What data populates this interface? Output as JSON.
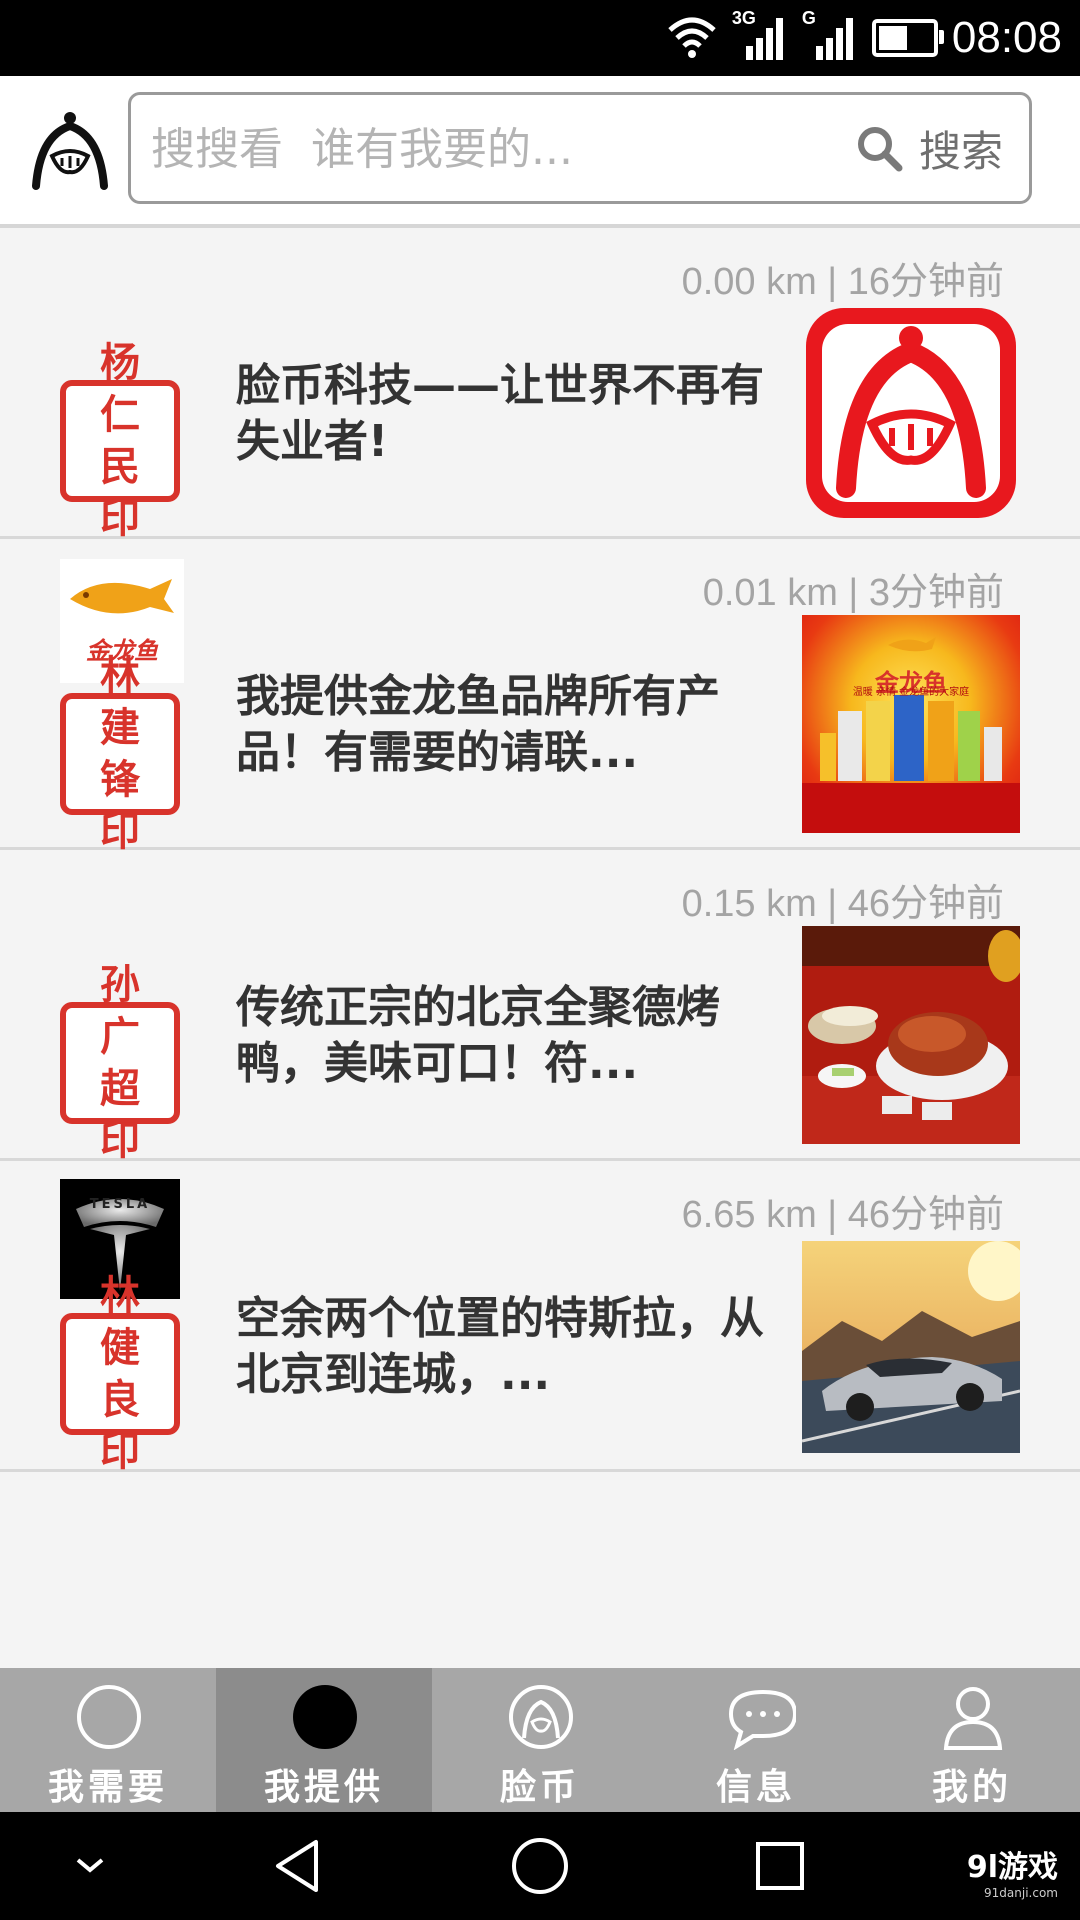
{
  "status_bar": {
    "time": "08:08",
    "net_3g": "3G",
    "net_g": "G",
    "battery_level": 0.55
  },
  "search": {
    "placeholder": "搜搜看  谁有我要的...",
    "button_label": "搜索"
  },
  "posts": [
    {
      "meta": "0.00 km | 16分钟前",
      "seal": [
        "杨",
        "仁",
        "民",
        "印"
      ],
      "title": "脸币科技——让世界不再有失业者!",
      "brand": "none",
      "thumb": "app-logo"
    },
    {
      "meta": "0.01 km | 3分钟前",
      "seal": [
        "林",
        "建",
        "锋",
        "印"
      ],
      "title": "我提供金龙鱼品牌所有产品！有需要的请联...",
      "brand": "金龙鱼",
      "thumb_title": "金龙鱼",
      "thumb_slogan": "温暖 亲情 金龙鱼的大家庭",
      "thumb": "jinlongyu-products"
    },
    {
      "meta": "0.15 km | 46分钟前",
      "seal": [
        "孙",
        "广",
        "超",
        "印"
      ],
      "title": "传统正宗的北京全聚德烤鸭，美味可口！符...",
      "brand": "none",
      "thumb": "roast-duck"
    },
    {
      "meta": "6.65 km | 46分钟前",
      "seal": [
        "林",
        "健",
        "良",
        "印"
      ],
      "title": "空余两个位置的特斯拉，从北京到连城，...",
      "brand": "TESLA",
      "thumb": "tesla-car"
    }
  ],
  "tabs": [
    {
      "label": "我需要",
      "icon": "circle-outline-icon",
      "active": false
    },
    {
      "label": "我提供",
      "icon": "circle-filled-icon",
      "active": true
    },
    {
      "label": "脸币",
      "icon": "lianbi-logo-icon",
      "active": false
    },
    {
      "label": "信息",
      "icon": "chat-bubble-icon",
      "active": false
    },
    {
      "label": "我的",
      "icon": "person-icon",
      "active": false
    }
  ],
  "watermark": {
    "line1": "9l游戏",
    "line2": "91danji.com"
  },
  "colors": {
    "seal_red": "#d8332b",
    "tab_bg": "#a7a7a7",
    "tab_active": "#8c8c8c"
  }
}
